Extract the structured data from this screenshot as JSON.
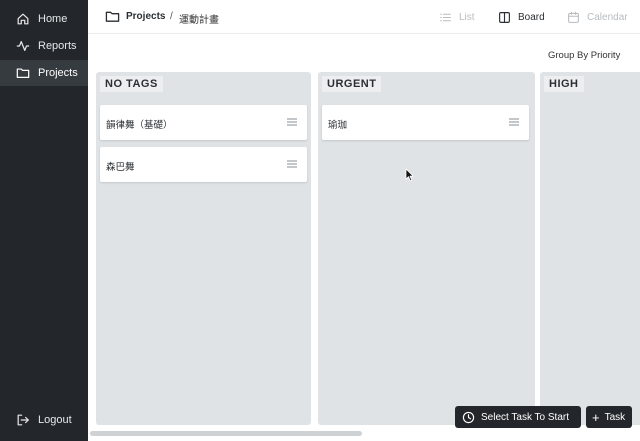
{
  "sidebar": {
    "items": [
      {
        "label": "Home",
        "icon": "home-icon"
      },
      {
        "label": "Reports",
        "icon": "activity-icon"
      },
      {
        "label": "Projects",
        "icon": "folder-icon",
        "active": true
      }
    ],
    "logout_label": "Logout"
  },
  "header": {
    "breadcrumb_root": "Projects",
    "breadcrumb_separator": "/",
    "breadcrumb_current": "運動計畫",
    "views": {
      "list": "List",
      "board": "Board",
      "calendar": "Calendar"
    },
    "active_view": "Board"
  },
  "toolbar": {
    "group_by_label": "Group By Priority"
  },
  "board": {
    "columns": [
      {
        "title": "NO TAGS",
        "cards": [
          {
            "label": "韻律舞（基礎）"
          },
          {
            "label": "森巴舞"
          }
        ]
      },
      {
        "title": "URGENT",
        "cards": [
          {
            "label": "瑜珈"
          }
        ]
      },
      {
        "title": "HIGH",
        "cards": []
      }
    ]
  },
  "actions": {
    "select_task_label": "Select Task To Start",
    "add_task_label": "Task"
  },
  "colors": {
    "sidebar_bg": "#23272b",
    "sidebar_active": "#363b40",
    "column_bg": "#dfe3e6",
    "card_bg": "#ffffff",
    "button_bg": "#23272b"
  }
}
